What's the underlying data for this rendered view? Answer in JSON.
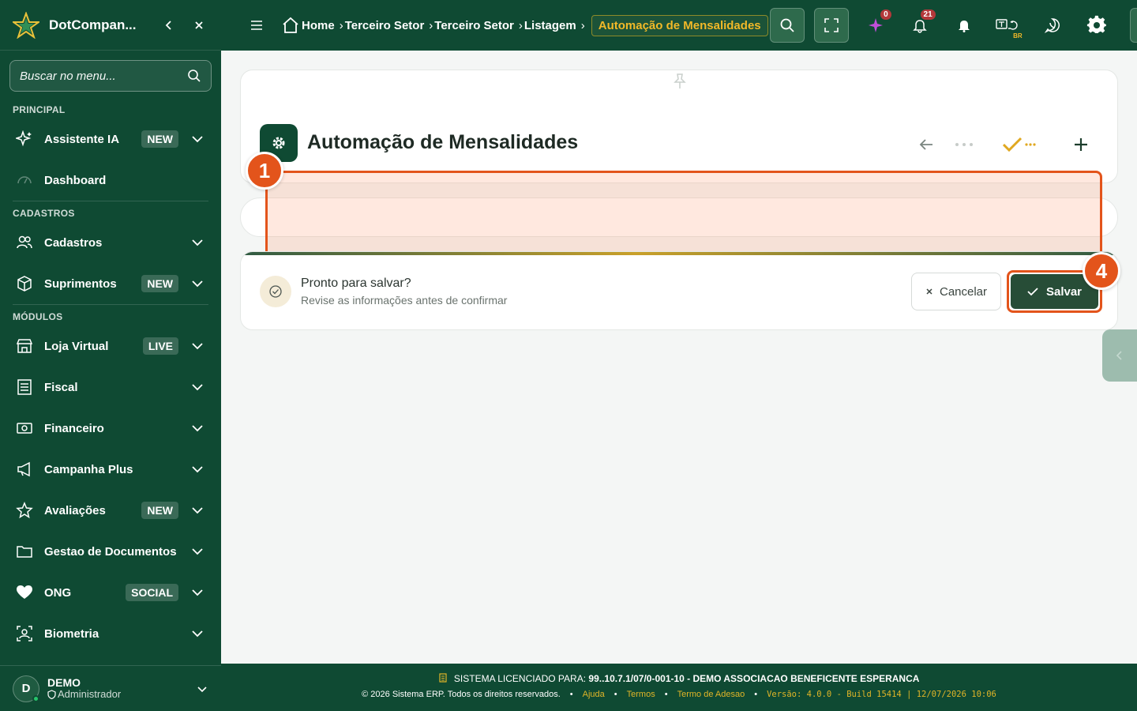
{
  "brand": {
    "name": "DotCompan..."
  },
  "search": {
    "placeholder": "Buscar no menu..."
  },
  "sections": {
    "principal": "PRINCIPAL",
    "cadastros": "CADASTROS",
    "modulos": "MÓDULOS"
  },
  "menu": {
    "assistente": {
      "label": "Assistente IA",
      "badge": "NEW"
    },
    "dashboard": {
      "label": "Dashboard"
    },
    "cadastros": {
      "label": "Cadastros"
    },
    "suprimentos": {
      "label": "Suprimentos",
      "badge": "NEW"
    },
    "loja": {
      "label": "Loja Virtual",
      "badge": "LIVE"
    },
    "fiscal": {
      "label": "Fiscal"
    },
    "financeiro": {
      "label": "Financeiro"
    },
    "campanha": {
      "label": "Campanha Plus"
    },
    "avaliacoes": {
      "label": "Avaliações",
      "badge": "NEW"
    },
    "gestao": {
      "label": "Gestao de Documentos"
    },
    "ong": {
      "label": "ONG",
      "badge": "SOCIAL"
    },
    "biometria": {
      "label": "Biometria"
    }
  },
  "user": {
    "initial": "D",
    "name": "DEMO",
    "role": "Administrador"
  },
  "breadcrumb": {
    "home": "Home",
    "c1": "Terceiro Setor",
    "c2": "Terceiro Setor",
    "c3": "Listagem",
    "active": "Automação de Mensalidades"
  },
  "topbar": {
    "ai_count": "0",
    "notif_count": "21",
    "lang": "BR"
  },
  "page": {
    "title": "Automação de Mensalidades",
    "save_prompt_title": "Pronto para salvar?",
    "save_prompt_sub": "Revise as informações antes de confirmar",
    "cancel_label": "Cancelar",
    "save_label": "Salvar"
  },
  "markers": {
    "m1": "1",
    "m4": "4"
  },
  "footer": {
    "license_label": "SISTEMA LICENCIADO PARA:",
    "license_value": "99..10.7.1/07/0-001-10 - DEMO ASSOCIACAO BENEFICENTE ESPERANCA",
    "copyright": "© 2026 Sistema ERP. Todos os direitos reservados.",
    "help": "Ajuda",
    "terms": "Termos",
    "adhesion": "Termo de Adesao",
    "version": "Versão: 4.0.0 - Build 15414 | 12/07/2026 10:06"
  },
  "colors": {
    "sidebar": "#0f4a33",
    "accent": "#f2b928",
    "highlight": "#e3541b",
    "save_button": "#274d37"
  }
}
